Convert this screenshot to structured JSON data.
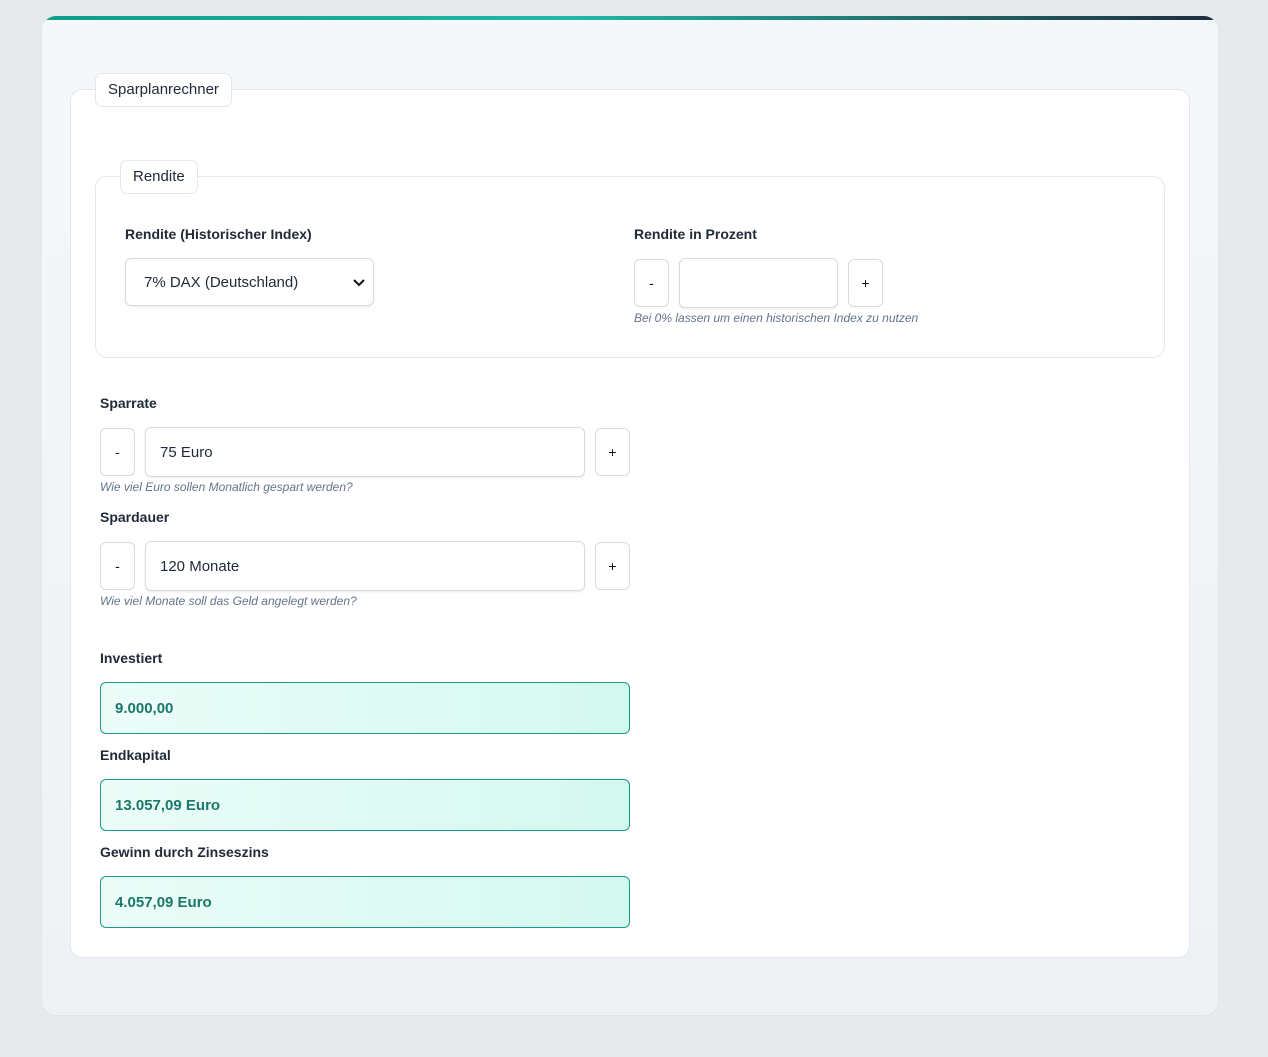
{
  "calculator": {
    "title": "Sparplanrechner"
  },
  "rendite": {
    "section_title": "Rendite",
    "index_label": "Rendite (Historischer Index)",
    "index_selected": "7% DAX (Deutschland)",
    "percent_label": "Rendite in Prozent",
    "percent_value": "",
    "percent_hint": "Bei 0% lassen um einen historischen Index zu nutzen"
  },
  "sparrate": {
    "label": "Sparrate",
    "value": "75 Euro",
    "hint": "Wie viel Euro sollen Monatlich gespart werden?"
  },
  "spardauer": {
    "label": "Spardauer",
    "value": "120 Monate",
    "hint": "Wie viel Monate soll das Geld angelegt werden?"
  },
  "stepper": {
    "minus": "-",
    "plus": "+"
  },
  "results": {
    "investiert_label": "Investiert",
    "investiert_value": "9.000,00",
    "endkapital_label": "Endkapital",
    "endkapital_value": "13.057,09 Euro",
    "gewinn_label": "Gewinn durch Zinseszins",
    "gewinn_value": "4.057,09 Euro"
  },
  "colors": {
    "accent": "#1a9a86",
    "result_text": "#1b7769"
  }
}
